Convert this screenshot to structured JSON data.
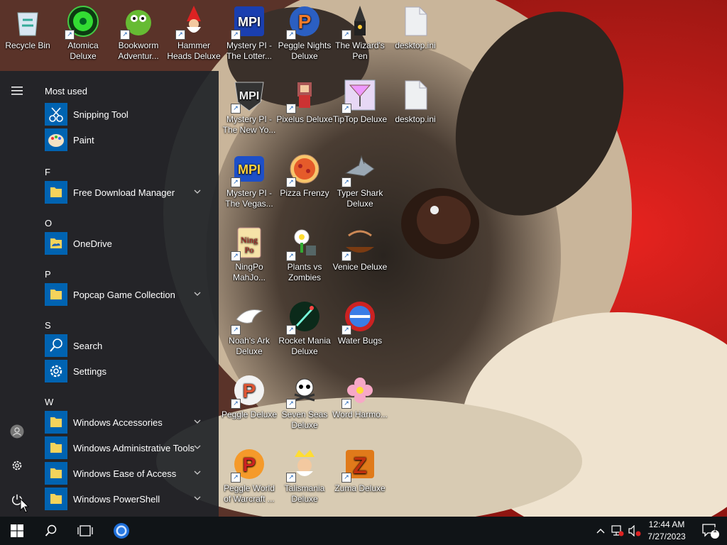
{
  "desktop": {
    "icons": [
      {
        "label": "Recycle Bin",
        "icon": "recycle-bin-icon"
      },
      {
        "label": "Atomica Deluxe",
        "icon": "atomica-icon"
      },
      {
        "label": "Bookworm Adventur...",
        "icon": "bookworm-icon"
      },
      {
        "label": "Hammer Heads Deluxe",
        "icon": "gnome-icon"
      },
      {
        "label": "Mystery PI - The Lotter...",
        "icon": "mystery-pi-icon"
      },
      {
        "label": "Peggle Nights Deluxe",
        "icon": "peggle-nights-icon"
      },
      {
        "label": "The Wizard's Pen",
        "icon": "wizard-pen-icon"
      },
      {
        "label": "desktop.ini",
        "icon": "file-icon"
      },
      {
        "label": "Mystery PI - The New Yo...",
        "icon": "mystery-pi-ny-icon"
      },
      {
        "label": "Pixelus Deluxe",
        "icon": "pixelus-icon"
      },
      {
        "label": "TipTop Deluxe",
        "icon": "cocktail-icon"
      },
      {
        "label": "desktop.ini",
        "icon": "file-icon"
      },
      {
        "label": "Mystery PI - The Vegas...",
        "icon": "mystery-pi-vegas-icon"
      },
      {
        "label": "Pizza Frenzy",
        "icon": "pizza-icon"
      },
      {
        "label": "Typer Shark Deluxe",
        "icon": "shark-icon"
      },
      {
        "label": "NingPo MahJo...",
        "icon": "ningpo-icon"
      },
      {
        "label": "Plants vs Zombies",
        "icon": "plant-icon"
      },
      {
        "label": "Venice Deluxe",
        "icon": "gondola-icon"
      },
      {
        "label": "Noah's Ark Deluxe",
        "icon": "dove-icon"
      },
      {
        "label": "Rocket Mania Deluxe",
        "icon": "rocket-icon"
      },
      {
        "label": "Water Bugs",
        "icon": "water-bugs-icon"
      },
      {
        "label": "Peggle Deluxe",
        "icon": "peggle-icon"
      },
      {
        "label": "Seven Seas Deluxe",
        "icon": "skull-icon"
      },
      {
        "label": "Word Harmo...",
        "icon": "flower-icon"
      },
      {
        "label": "Peggle World of Warcraft ...",
        "icon": "peggle-wow-icon"
      },
      {
        "label": "Talismania Deluxe",
        "icon": "talismania-icon"
      },
      {
        "label": "Zuma Deluxe",
        "icon": "zuma-icon"
      }
    ]
  },
  "start_menu": {
    "most_used_header": "Most used",
    "most_used": [
      {
        "label": "Snipping Tool",
        "icon": "scissors-icon"
      },
      {
        "label": "Paint",
        "icon": "palette-icon"
      }
    ],
    "groups": [
      {
        "letter": "F",
        "items": [
          {
            "label": "Free Download Manager",
            "icon": "folder-icon",
            "expandable": true
          }
        ]
      },
      {
        "letter": "O",
        "items": [
          {
            "label": "OneDrive",
            "icon": "onedrive-folder-icon",
            "expandable": false
          }
        ]
      },
      {
        "letter": "P",
        "items": [
          {
            "label": "Popcap Game Collection",
            "icon": "folder-icon",
            "expandable": true
          }
        ]
      },
      {
        "letter": "S",
        "items": [
          {
            "label": "Search",
            "icon": "search-icon",
            "expandable": false
          },
          {
            "label": "Settings",
            "icon": "gear-icon",
            "expandable": false
          }
        ]
      },
      {
        "letter": "W",
        "items": [
          {
            "label": "Windows Accessories",
            "icon": "folder-icon",
            "expandable": true
          },
          {
            "label": "Windows Administrative Tools",
            "icon": "folder-icon",
            "expandable": true
          },
          {
            "label": "Windows Ease of Access",
            "icon": "folder-icon",
            "expandable": true
          },
          {
            "label": "Windows PowerShell",
            "icon": "folder-icon",
            "expandable": true
          }
        ]
      }
    ]
  },
  "taskbar": {
    "time": "12:44 AM",
    "date": "7/27/2023",
    "notification_count": "1"
  },
  "colors": {
    "tile_blue": "#0063b1",
    "folder_yellow": "#f5d35b",
    "taskbar_bg": "#101417"
  }
}
